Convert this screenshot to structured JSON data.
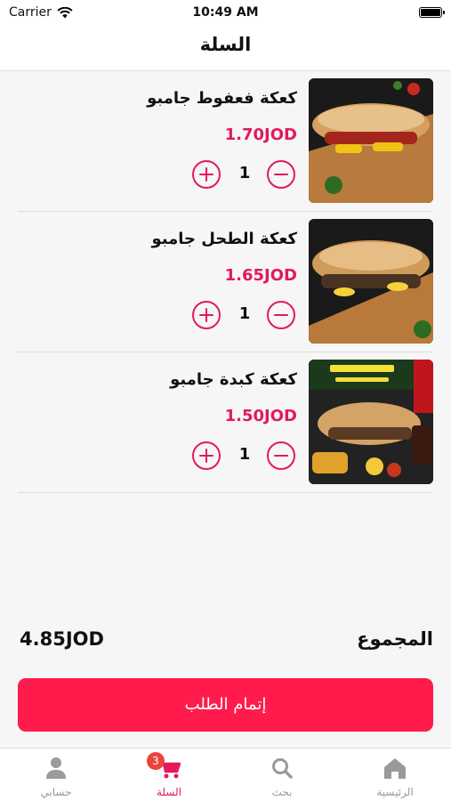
{
  "status_bar": {
    "carrier": "Carrier",
    "time": "10:49 AM"
  },
  "header": {
    "title": "السلة"
  },
  "cart": {
    "items": [
      {
        "name": "كعكة فعفوط جامبو",
        "price": "1.70JOD",
        "quantity": "1"
      },
      {
        "name": "كعكة الطحل جامبو",
        "price": "1.65JOD",
        "quantity": "1"
      },
      {
        "name": "كعكة كبدة جامبو",
        "price": "1.50JOD",
        "quantity": "1"
      }
    ]
  },
  "summary": {
    "total_label": "المجموع",
    "total_value": "4.85JOD"
  },
  "checkout": {
    "label": "إتمام الطلب"
  },
  "tab_bar": {
    "tabs": [
      {
        "label": "الرئيسية",
        "icon": "home-icon"
      },
      {
        "label": "بحث",
        "icon": "search-icon"
      },
      {
        "label": "السلة",
        "icon": "cart-icon",
        "badge": "3"
      },
      {
        "label": "حسابي",
        "icon": "person-icon"
      }
    ]
  },
  "colors": {
    "accent": "#e3195a",
    "checkout": "#ff1c4d",
    "badge": "#e8443b",
    "inactive": "#9a9a9a"
  }
}
